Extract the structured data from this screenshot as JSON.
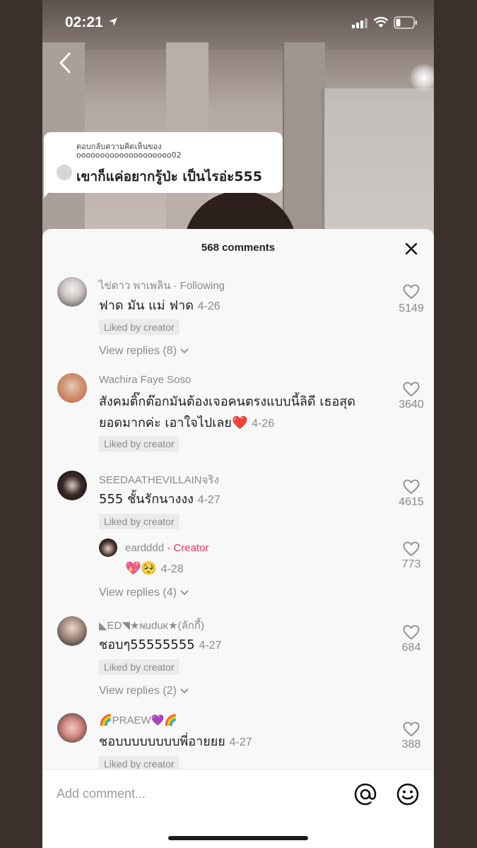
{
  "status_bar": {
    "time": "02:21"
  },
  "reply_bubble": {
    "header": "ตอบกลับความคิดเห็นของ",
    "username": "oooooooooooooooooooo02",
    "text": "เขาก็แค่อยากรู้ป่ะ เป็นไรอ่ะ555"
  },
  "panel": {
    "title": "568 comments"
  },
  "comments": [
    {
      "username": "ไข่ดาว พาเพลิน",
      "tag": "· Following",
      "text": "ฟาด มัน แม่ ฟาด",
      "date": "4-26",
      "liked_badge": "Liked by creator",
      "likes": "5149",
      "view_replies": "View replies (8)"
    },
    {
      "username": "Wachira Faye Soso",
      "text_line1": "สังคมติ๊กต๊อกมันต้องเจอคนตรงแบบนี้ลิดี เธอสุด",
      "text_line2": "ยอดมากค่ะ เอาใจไปเลย❤️",
      "date": "4-26",
      "liked_badge": "Liked by creator",
      "likes": "3640"
    },
    {
      "username": "SEEDAATHEVILLAINจริง",
      "text": "555 ชั้นรักนางงง",
      "date": "4-27",
      "liked_badge": "Liked by creator",
      "likes": "4615",
      "reply": {
        "username": "eardddd",
        "tag": "· Creator",
        "text": "💖🥺",
        "date": "4-28",
        "likes": "773"
      },
      "view_replies": "View replies (4)"
    },
    {
      "username": "◣ED◥★ɴuduĸ★(ลักกี้)",
      "text": "ชอบๆ55555555",
      "date": "4-27",
      "liked_badge": "Liked by creator",
      "likes": "684",
      "view_replies": "View replies (2)"
    },
    {
      "username": "🌈PRAEW💜🌈",
      "text": "ชอบบบบบบบบพี่อายยย",
      "date": "4-27",
      "liked_badge": "Liked by creator",
      "likes": "388"
    }
  ],
  "comment_bar": {
    "placeholder": "Add comment..."
  },
  "colors": {
    "creator_tag": "#e8345a",
    "muted_text": "#8a8a8a",
    "panel_bg": "#f8f8f8"
  },
  "icons": [
    "location-arrow-icon",
    "signal-icon",
    "wifi-icon",
    "battery-icon",
    "back-chevron-icon",
    "close-icon",
    "heart-icon",
    "chevron-down-icon",
    "mention-icon",
    "emoji-icon"
  ]
}
